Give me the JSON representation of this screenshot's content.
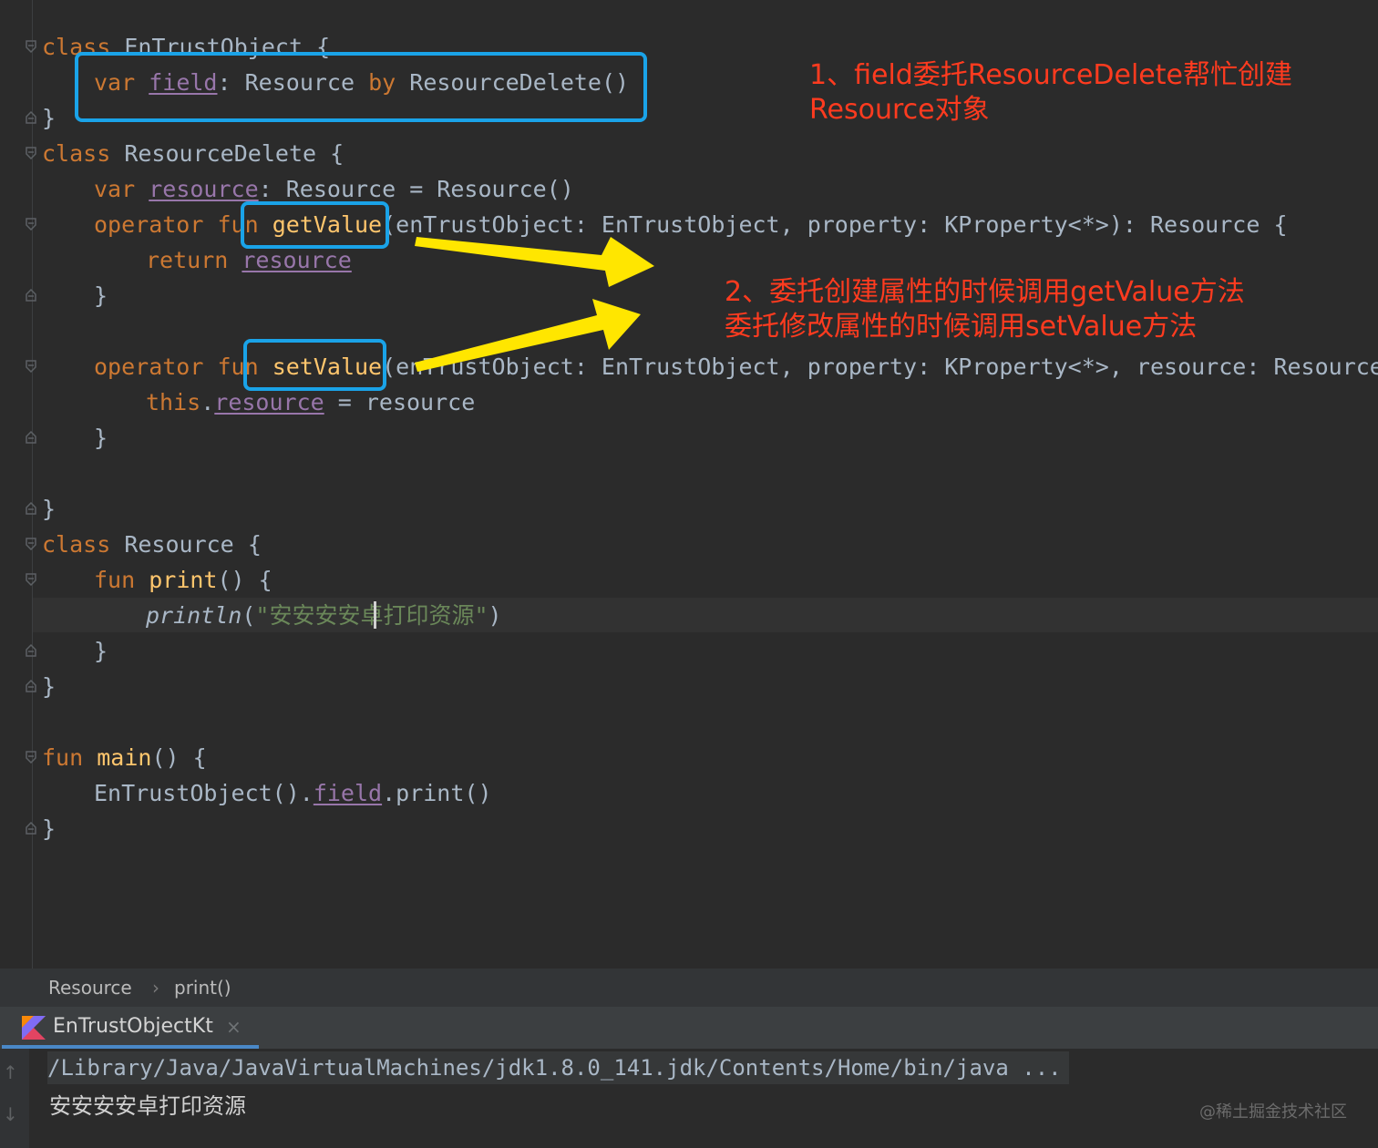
{
  "code": {
    "l1": {
      "kw": "class",
      "name": "EnTrustObject",
      "brace": "{"
    },
    "l2": {
      "kw1": "var",
      "prop": "field",
      "colon": ":",
      "type": "Resource",
      "kw2": "by",
      "call": "ResourceDelete()"
    },
    "l3": {
      "brace": "}"
    },
    "l4": {
      "kw": "class",
      "name": "ResourceDelete",
      "brace": "{"
    },
    "l5": {
      "kw": "var",
      "prop": "resource",
      "rest": ": Resource = Resource()"
    },
    "l6": {
      "kw": "operator fun",
      "fn": "getValue",
      "rest": "(enTrustObject: EnTrustObject, property: KProperty<*>): Resource {"
    },
    "l7": {
      "kw": "return",
      "prop": "resource"
    },
    "l8": {
      "brace": "}"
    },
    "l9": {
      "kw": "operator fun",
      "fn": "setValue",
      "rest": "(enTrustObject: EnTrustObject, property: KProperty<*>, resource: Resource) {"
    },
    "l10": {
      "kw": "this",
      "dot": ".",
      "prop": "resource",
      "rest": " = resource"
    },
    "l11": {
      "brace": "}"
    },
    "l12": {
      "brace": "}"
    },
    "l13": {
      "kw": "class",
      "name": "Resource",
      "brace": "{"
    },
    "l14": {
      "kw": "fun",
      "fn": "print",
      "rest": "() {"
    },
    "l15": {
      "fn": "println",
      "open": "(",
      "str": "\"安安安安卓打印资源\"",
      "close": ")"
    },
    "l16": {
      "brace": "}"
    },
    "l17": {
      "brace": "}"
    },
    "l18": {
      "kw": "fun",
      "fn": "main",
      "rest": "() {"
    },
    "l19": {
      "pre": "EnTrustObject().",
      "prop": "field",
      "rest": ".print()"
    },
    "l20": {
      "brace": "}"
    }
  },
  "annotations": {
    "note1": "1、field委托ResourceDelete帮忙创建\nResource对象",
    "note2": "2、委托创建属性的时候调用getValue方法\n委托修改属性的时候调用setValue方法"
  },
  "breadcrumb": {
    "item1": "Resource",
    "sep": "›",
    "item2": "print()"
  },
  "run": {
    "tab_label": "EnTrustObjectKt",
    "close": "×"
  },
  "console": {
    "command": "/Library/Java/JavaVirtualMachines/jdk1.8.0_141.jdk/Contents/Home/bin/java ...",
    "output": "安安安安卓打印资源",
    "up": "↑",
    "down": "↓"
  },
  "watermark": "@稀土掘金技术社区",
  "colors": {
    "editor_bg": "#2b2b2b",
    "keyword": "#cc7832",
    "function": "#ffc66d",
    "property": "#9876aa",
    "string": "#6a8759",
    "highlight_box": "#1aa3e8",
    "annotation_text": "#ff3b1f",
    "arrow": "#ffe600"
  }
}
